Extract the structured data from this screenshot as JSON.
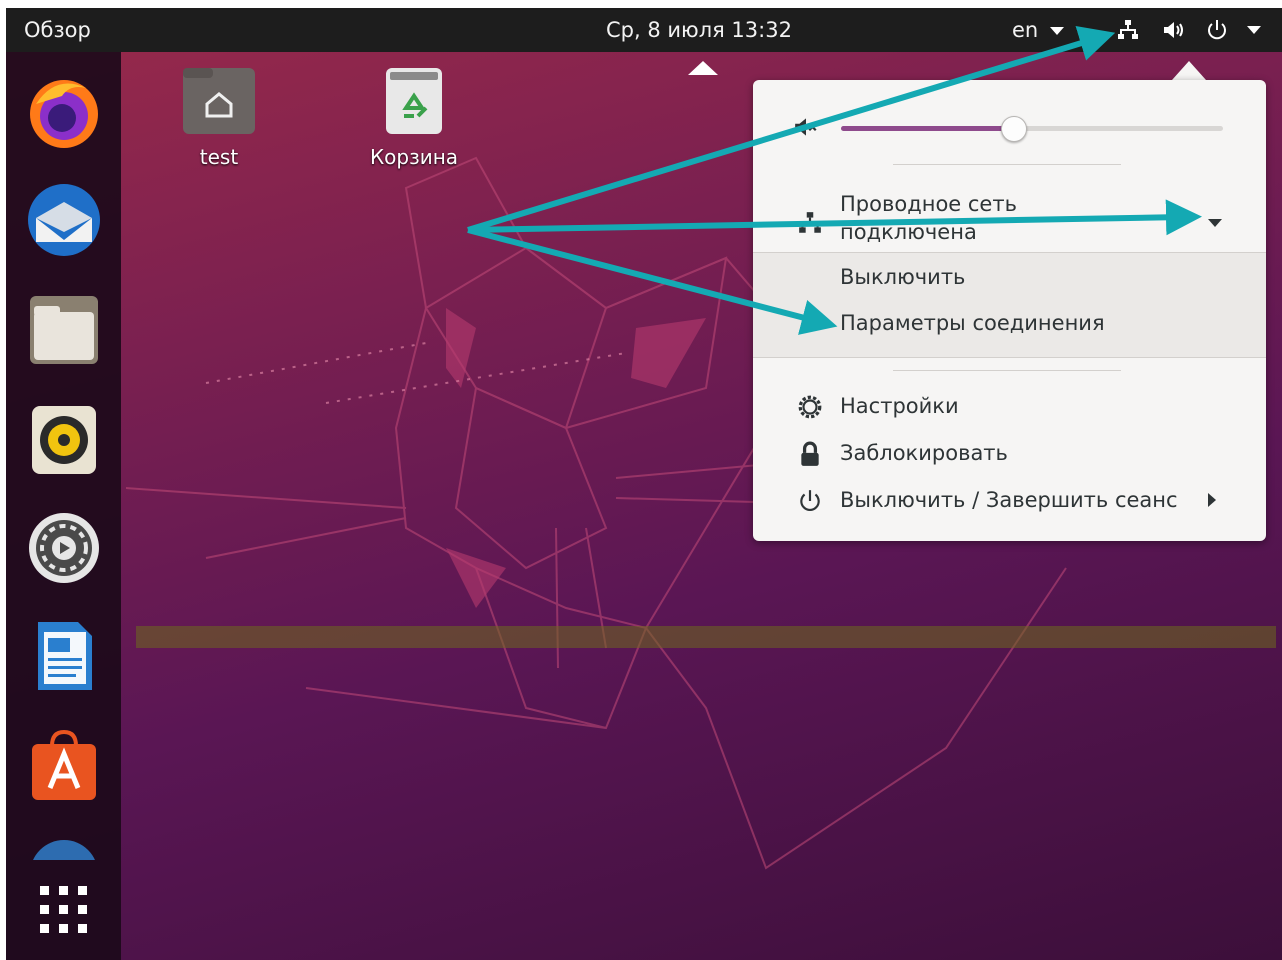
{
  "topbar": {
    "activities_label": "Обзор",
    "clock": "Ср, 8 июля  13:32",
    "keyboard_layout": "en"
  },
  "dock": {
    "apps": [
      {
        "icon": "firefox-icon"
      },
      {
        "icon": "thunderbird-icon"
      },
      {
        "icon": "files-icon"
      },
      {
        "icon": "rhythmbox-icon"
      },
      {
        "icon": "settings-icon"
      },
      {
        "icon": "libreoffice-writer-icon"
      },
      {
        "icon": "ubuntu-software-icon"
      },
      {
        "icon": "help-icon"
      }
    ],
    "show_apps_icon": "app-grid-icon"
  },
  "desktop": {
    "icons": [
      {
        "label": "test",
        "icon": "home-folder-icon"
      },
      {
        "label": "Корзина",
        "icon": "trash-icon"
      }
    ]
  },
  "system_menu": {
    "volume_level": 0.45,
    "wired_title": "Проводное сеть",
    "wired_status": "подключена",
    "turn_off": "Выключить",
    "connection_settings": "Параметры соединения",
    "settings": "Настройки",
    "lock": "Заблокировать",
    "power_off": "Выключить / Завершить сеанс"
  },
  "colors": {
    "accent_arrows": "#14a9b3",
    "volume_fill": "#8e4a8c",
    "topbar_bg": "#1d1d1d",
    "menu_bg": "#f6f5f4"
  }
}
